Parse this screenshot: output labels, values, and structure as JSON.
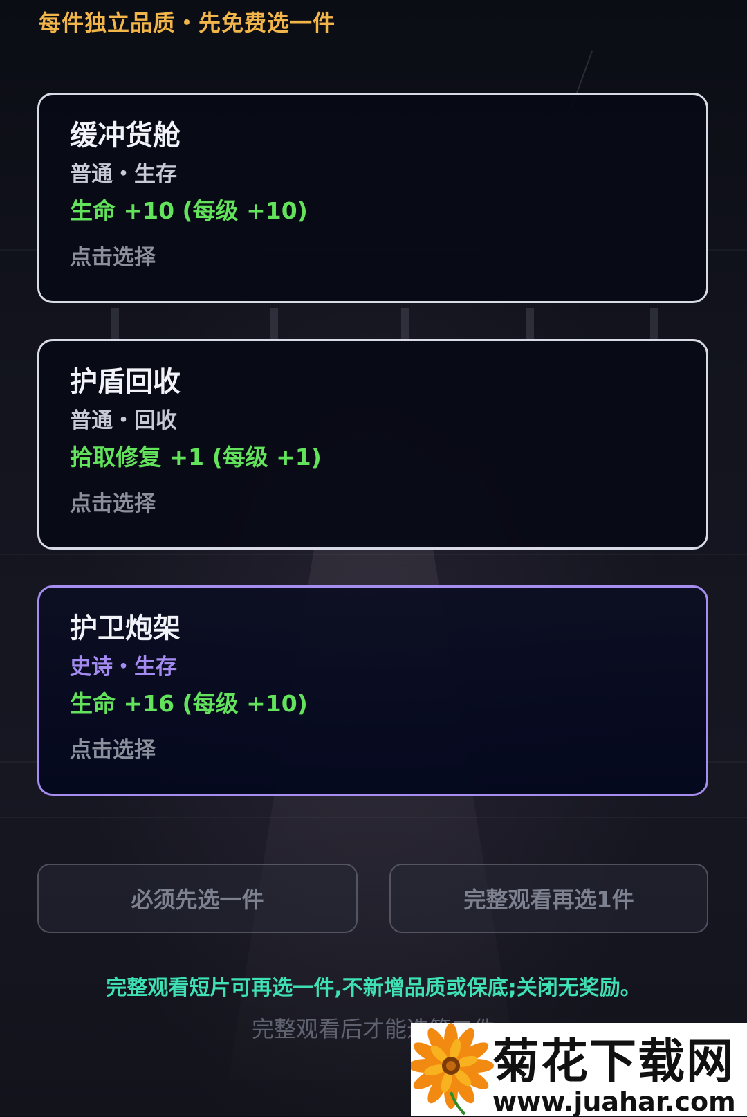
{
  "header": {
    "text": "每件独立品质・先免费选一件"
  },
  "cards": [
    {
      "title": "缓冲货舱",
      "subtitle": "普通・生存",
      "stat": "生命 +10 (每级 +10)",
      "hint": "点击选择"
    },
    {
      "title": "护盾回收",
      "subtitle": "普通・回收",
      "stat": "拾取修复 +1 (每级 +1)",
      "hint": "点击选择"
    },
    {
      "title": "护卫炮架",
      "subtitle": "史诗・生存",
      "stat": "生命 +16 (每级 +10)",
      "hint": "点击选择"
    }
  ],
  "buttons": {
    "must_select": "必须先选一件",
    "watch_select": "完整观看再选1件"
  },
  "notes": {
    "info": "完整观看短片可再选一件,不新增品质或保底;关闭无奖励。",
    "watch_hint": "完整观看后才能选第二件"
  },
  "watermark": {
    "title": "菊花下载网",
    "url": "www.juahar.com"
  },
  "colors": {
    "header": "#f2b54a",
    "stat_green": "#62e35b",
    "epic_purple": "#a48bf2",
    "note_teal": "#3fe0b4"
  }
}
